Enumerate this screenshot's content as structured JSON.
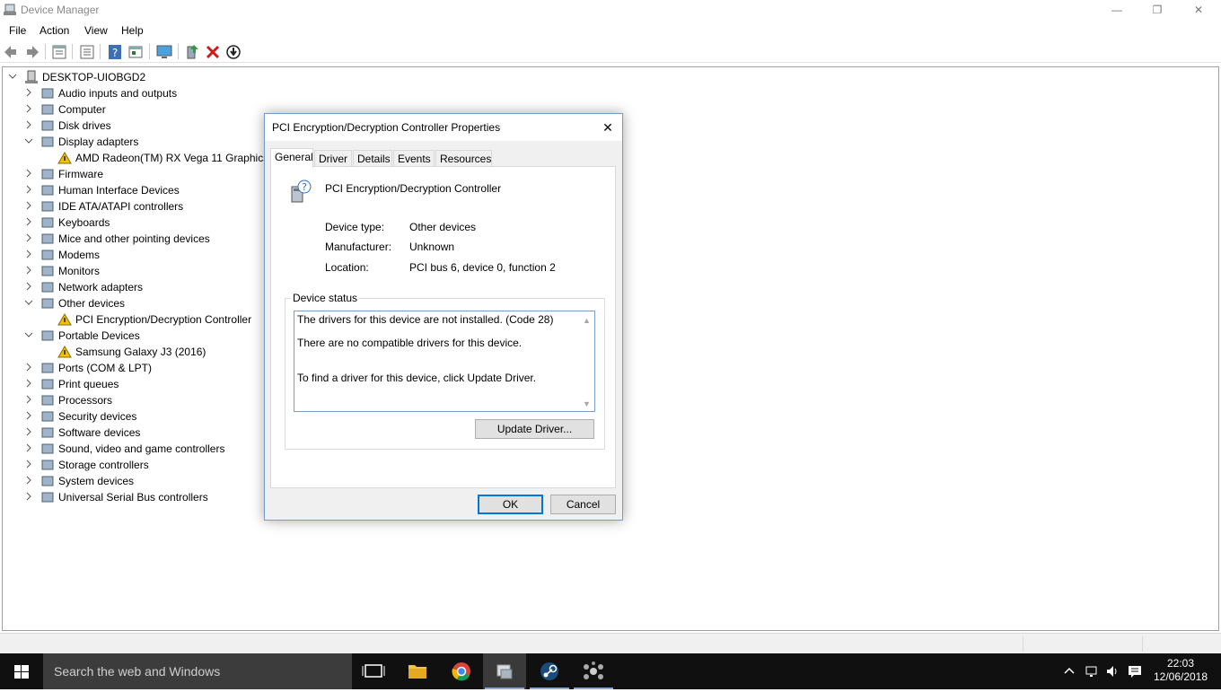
{
  "window": {
    "title": "Device Manager",
    "controls": {
      "minimize": "—",
      "maximize": "❐",
      "close": "✕"
    }
  },
  "menu": [
    "File",
    "Action",
    "View",
    "Help"
  ],
  "toolbar": [
    "back-icon",
    "forward-icon",
    "properties-icon",
    "list-icon",
    "help-icon",
    "view-icon",
    "monitor-icon",
    "update-driver-icon",
    "uninstall-icon",
    "download-icon"
  ],
  "tree": {
    "root": "DESKTOP-UIOBGD2",
    "items": [
      {
        "label": "Audio inputs and outputs",
        "expanded": false
      },
      {
        "label": "Computer",
        "expanded": false
      },
      {
        "label": "Disk drives",
        "expanded": false
      },
      {
        "label": "Display adapters",
        "expanded": true
      },
      {
        "label": "AMD Radeon(TM) RX Vega 11 Graphics",
        "child": true
      },
      {
        "label": "Firmware",
        "expanded": false
      },
      {
        "label": "Human Interface Devices",
        "expanded": false
      },
      {
        "label": "IDE ATA/ATAPI controllers",
        "expanded": false
      },
      {
        "label": "Keyboards",
        "expanded": false
      },
      {
        "label": "Mice and other pointing devices",
        "expanded": false
      },
      {
        "label": "Modems",
        "expanded": false
      },
      {
        "label": "Monitors",
        "expanded": false
      },
      {
        "label": "Network adapters",
        "expanded": false
      },
      {
        "label": "Other devices",
        "expanded": true
      },
      {
        "label": "PCI Encryption/Decryption Controller",
        "child": true
      },
      {
        "label": "Portable Devices",
        "expanded": true
      },
      {
        "label": "Samsung Galaxy J3 (2016)",
        "child": true
      },
      {
        "label": "Ports (COM & LPT)",
        "expanded": false
      },
      {
        "label": "Print queues",
        "expanded": false
      },
      {
        "label": "Processors",
        "expanded": false
      },
      {
        "label": "Security devices",
        "expanded": false
      },
      {
        "label": "Software devices",
        "expanded": false
      },
      {
        "label": "Sound, video and game controllers",
        "expanded": false
      },
      {
        "label": "Storage controllers",
        "expanded": false
      },
      {
        "label": "System devices",
        "expanded": false
      },
      {
        "label": "Universal Serial Bus controllers",
        "expanded": false
      }
    ]
  },
  "dialog": {
    "title": "PCI Encryption/Decryption Controller Properties",
    "tabs": [
      "General",
      "Driver",
      "Details",
      "Events",
      "Resources"
    ],
    "selected_tab": "General",
    "device_name": "PCI Encryption/Decryption Controller",
    "properties": [
      {
        "label": "Device type:",
        "value": "Other devices"
      },
      {
        "label": "Manufacturer:",
        "value": "Unknown"
      },
      {
        "label": "Location:",
        "value": "PCI bus 6, device 0, function 2"
      }
    ],
    "status_group_label": "Device status",
    "status_lines": [
      "The drivers for this device are not installed. (Code 28)",
      "There are no compatible drivers for this device.",
      "To find a driver for this device, click Update Driver."
    ],
    "update_driver_label": "Update Driver...",
    "ok_label": "OK",
    "cancel_label": "Cancel",
    "close_label": "✕"
  },
  "taskbar": {
    "search_placeholder": "Search the web and Windows",
    "clock_time": "22:03",
    "clock_date": "12/06/2018"
  },
  "colors": {
    "accent": "#0078d7",
    "warning": "#f2c200",
    "taskbar": "#101010",
    "dialog_border": "#6e9dd5"
  }
}
